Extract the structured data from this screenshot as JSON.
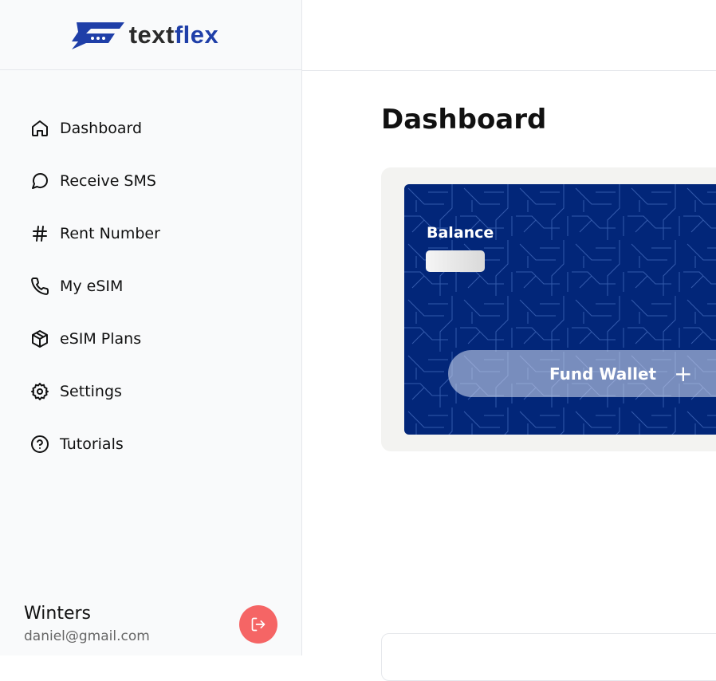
{
  "brand": {
    "logo_part1": "text",
    "logo_part2": "flex"
  },
  "sidebar": {
    "items": [
      {
        "label": "Dashboard",
        "icon": "home-icon"
      },
      {
        "label": "Receive SMS",
        "icon": "message-circle-icon"
      },
      {
        "label": "Rent Number",
        "icon": "hash-icon"
      },
      {
        "label": "My eSIM",
        "icon": "phone-icon"
      },
      {
        "label": "eSIM Plans",
        "icon": "package-icon"
      },
      {
        "label": "Settings",
        "icon": "gear-icon"
      },
      {
        "label": "Tutorials",
        "icon": "help-circle-icon"
      }
    ]
  },
  "user": {
    "name": "Winters",
    "email": "daniel@gmail.com"
  },
  "main": {
    "title": "Dashboard",
    "balance_label": "Balance",
    "fund_wallet_label": "Fund Wallet",
    "fund_wallet_icon": "+"
  },
  "colors": {
    "card": "#022679",
    "logout": "#f56565",
    "brand_blue": "#1f3fa8"
  }
}
